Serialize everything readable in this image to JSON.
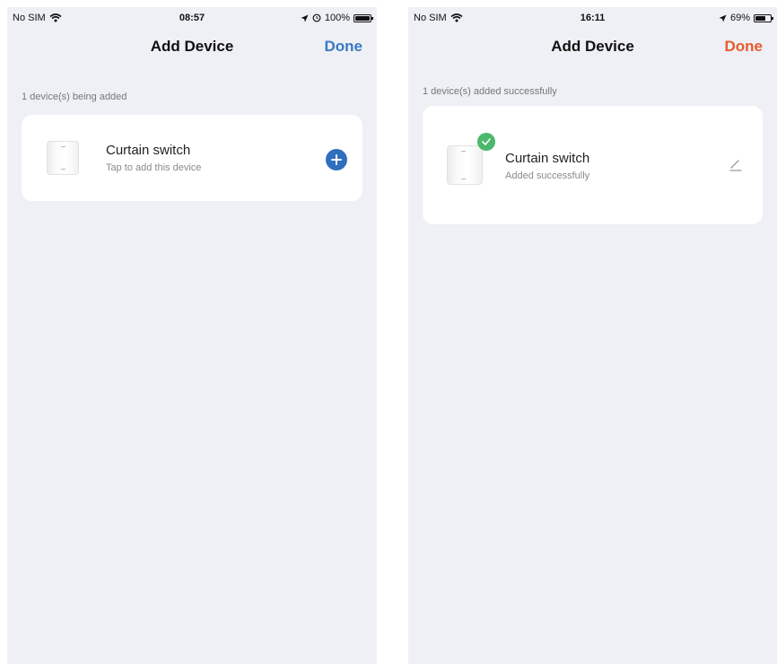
{
  "colors": {
    "background": "#eef0f5",
    "card": "#ffffff",
    "done_left": "#3a78c4",
    "done_right": "#e85a2e",
    "add_button": "#2f6fbd",
    "success_badge": "#4cb86c"
  },
  "screens": [
    {
      "status": {
        "carrier": "No SIM",
        "time": "08:57",
        "battery": "100%",
        "battery_level": 1.0,
        "icons": [
          "wifi-icon",
          "location-icon",
          "alarm-icon",
          "battery-icon"
        ]
      },
      "nav": {
        "title": "Add Device",
        "done": "Done"
      },
      "section_label": "1 device(s) being added",
      "device": {
        "name": "Curtain switch",
        "subtitle": "Tap to add this device",
        "action_icon": "plus-circle-icon"
      }
    },
    {
      "status": {
        "carrier": "No SIM",
        "time": "16:11",
        "battery": "69%",
        "battery_level": 0.69,
        "icons": [
          "wifi-icon",
          "location-icon",
          "battery-icon"
        ]
      },
      "nav": {
        "title": "Add Device",
        "done": "Done"
      },
      "section_label": "1 device(s) added successfully",
      "device": {
        "name": "Curtain switch",
        "subtitle": "Added successfully",
        "badge_icon": "check-badge-icon",
        "action_icon": "pencil-icon"
      }
    }
  ]
}
